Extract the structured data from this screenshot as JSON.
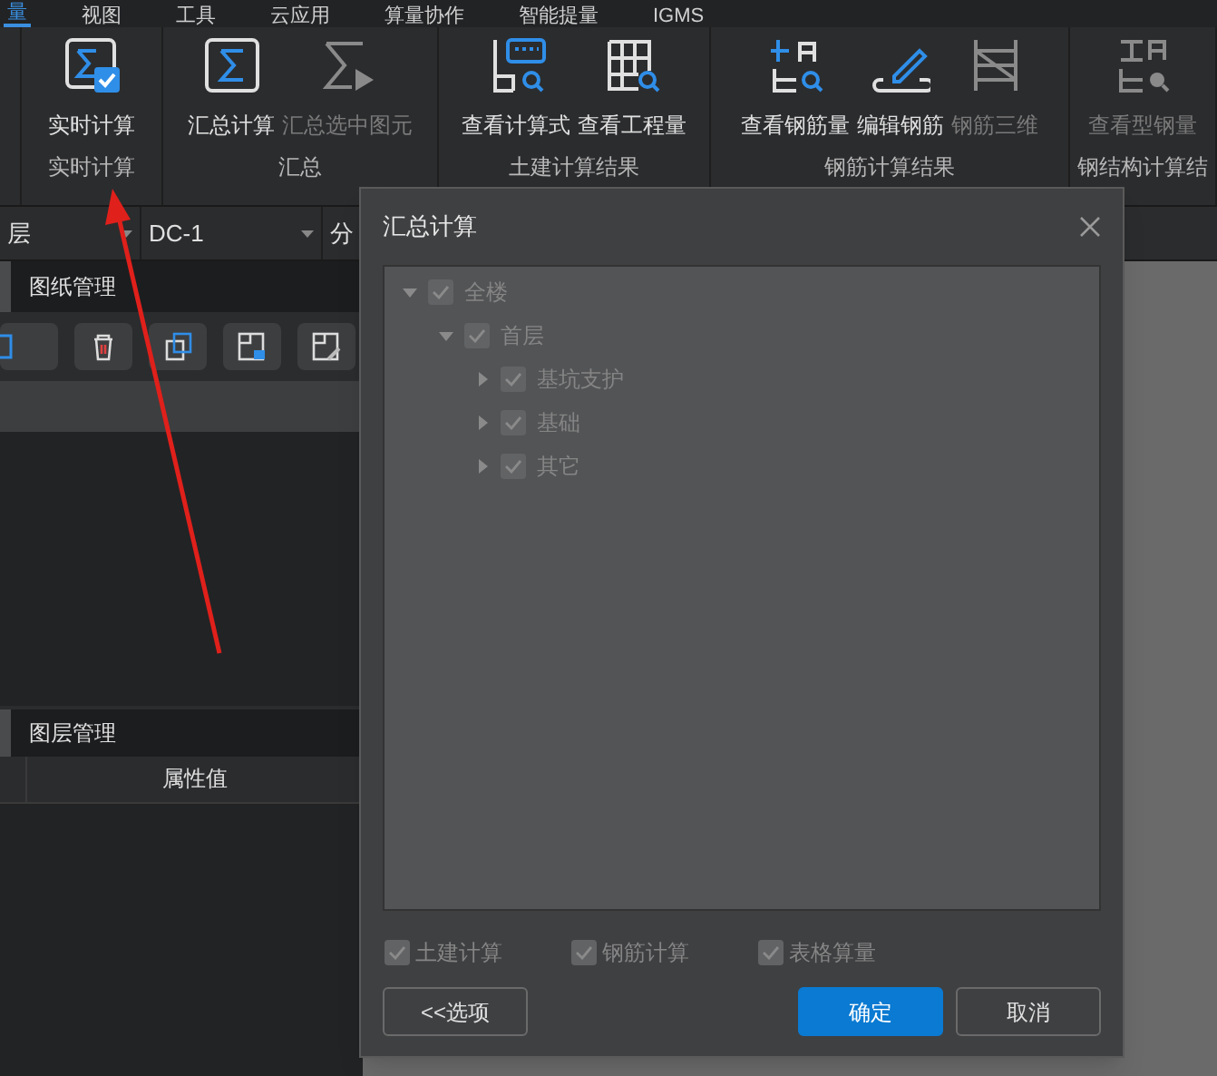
{
  "menu_tabs": [
    {
      "label": "量",
      "selected": true
    },
    {
      "label": "视图",
      "selected": false
    },
    {
      "label": "工具",
      "selected": false
    },
    {
      "label": "云应用",
      "selected": false
    },
    {
      "label": "算量协作",
      "selected": false
    },
    {
      "label": "智能提量",
      "selected": false
    },
    {
      "label": "IGMS",
      "selected": false
    }
  ],
  "ribbon_groups": [
    {
      "label": "实时计算",
      "buttons": [
        {
          "label": "实时计算",
          "disabled": false
        }
      ]
    },
    {
      "label": "汇总",
      "buttons": [
        {
          "label": "汇总计算",
          "disabled": false
        },
        {
          "label": "汇总选中图元",
          "disabled": true
        }
      ]
    },
    {
      "label": "土建计算结果",
      "buttons": [
        {
          "label": "查看计算式",
          "disabled": false
        },
        {
          "label": "查看工程量",
          "disabled": false
        }
      ]
    },
    {
      "label": "钢筋计算结果",
      "buttons": [
        {
          "label": "查看钢筋量",
          "disabled": false
        },
        {
          "label": "编辑钢筋",
          "disabled": false
        },
        {
          "label": "钢筋三维",
          "disabled": true
        }
      ]
    },
    {
      "label": "钢结构计算结",
      "buttons": [
        {
          "label": "查看型钢量",
          "disabled": true
        }
      ]
    }
  ],
  "selectors": [
    {
      "value": "层"
    },
    {
      "value": "DC-1"
    },
    {
      "value": "分"
    }
  ],
  "drawing_panel": {
    "title": "图纸管理"
  },
  "layer_panel": {
    "title": "图层管理",
    "columns": [
      "属性值"
    ]
  },
  "dialog": {
    "title": "汇总计算",
    "tree": [
      {
        "label": "全楼",
        "checked": true,
        "expanded": true,
        "children": [
          {
            "label": "首层",
            "checked": true,
            "expanded": true,
            "children": [
              {
                "label": "基坑支护",
                "checked": true,
                "expanded": false
              },
              {
                "label": "基础",
                "checked": true,
                "expanded": false
              },
              {
                "label": "其它",
                "checked": true,
                "expanded": false
              }
            ]
          }
        ]
      }
    ],
    "options": [
      {
        "label": "土建计算",
        "checked": true
      },
      {
        "label": "钢筋计算",
        "checked": true
      },
      {
        "label": "表格算量",
        "checked": true
      }
    ],
    "buttons": [
      {
        "label": "<<选项",
        "kind": "secondary"
      },
      {
        "label": "确定",
        "kind": "primary"
      },
      {
        "label": "取消",
        "kind": "secondary"
      }
    ]
  }
}
